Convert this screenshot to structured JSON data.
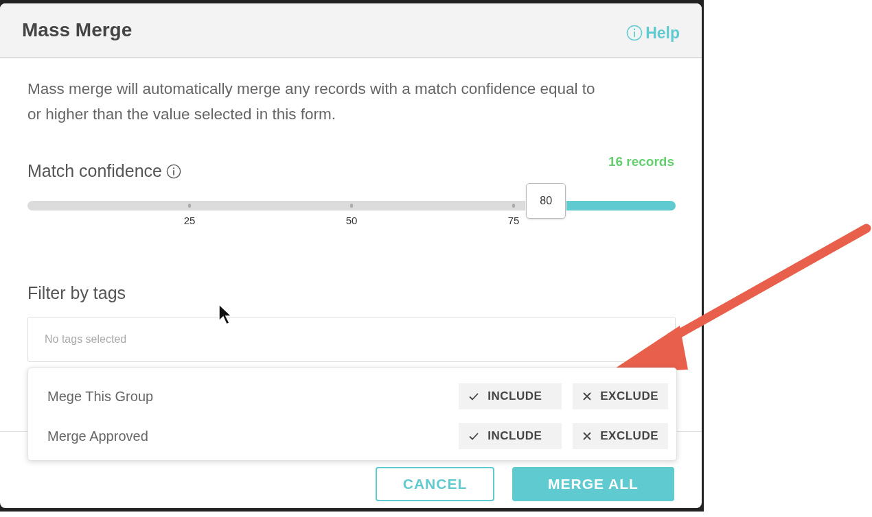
{
  "dialog": {
    "title": "Mass Merge",
    "help": "Help"
  },
  "description": "Mass merge will automatically merge any records with a match confidence equal to or higher than the value selected in this form.",
  "match_confidence": {
    "label": "Match confidence",
    "records": "16 records",
    "slider": {
      "value": "80",
      "ticks": [
        "25",
        "50",
        "75"
      ]
    }
  },
  "filter": {
    "label": "Filter by tags",
    "field": {
      "placeholder": "No tags selected"
    },
    "options": [
      {
        "name": "Mege This Group",
        "include": "INCLUDE",
        "exclude": "EXCLUDE"
      },
      {
        "name": "Merge Approved",
        "include": "INCLUDE",
        "exclude": "EXCLUDE"
      }
    ]
  },
  "buttons": [
    {
      "label": "CANCEL",
      "kind": "outline"
    },
    {
      "label": "MERGE ALL",
      "kind": "primary"
    }
  ]
}
